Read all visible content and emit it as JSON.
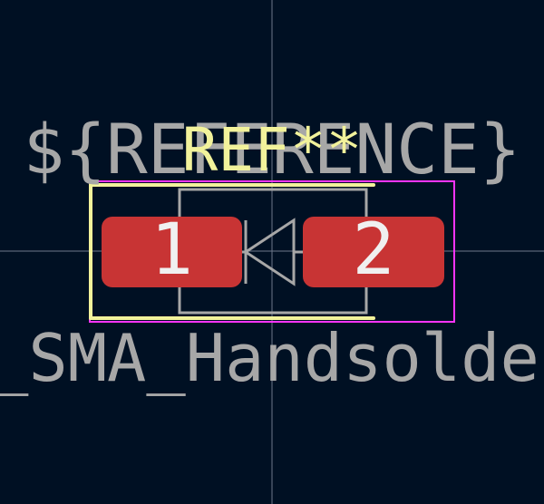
{
  "footprint": {
    "reference_field": "${REFERENCE}",
    "reference_designator": "REF**",
    "value_field": "_SMA_Handsoldering",
    "pads": [
      {
        "number": "1"
      },
      {
        "number": "2"
      }
    ]
  },
  "colors": {
    "background": "#001023",
    "crosshair": "#8a93a6",
    "fab_text": "#a7a7a7",
    "silk_text": "#f2f29b",
    "silkscreen": "#f2f29b",
    "courtyard": "#ff34ff",
    "fab_outline": "#a7a7a7",
    "pad": "#c83434",
    "pad_number": "#f0f0f0"
  },
  "icons": {
    "diode_symbol": "diode-icon"
  }
}
